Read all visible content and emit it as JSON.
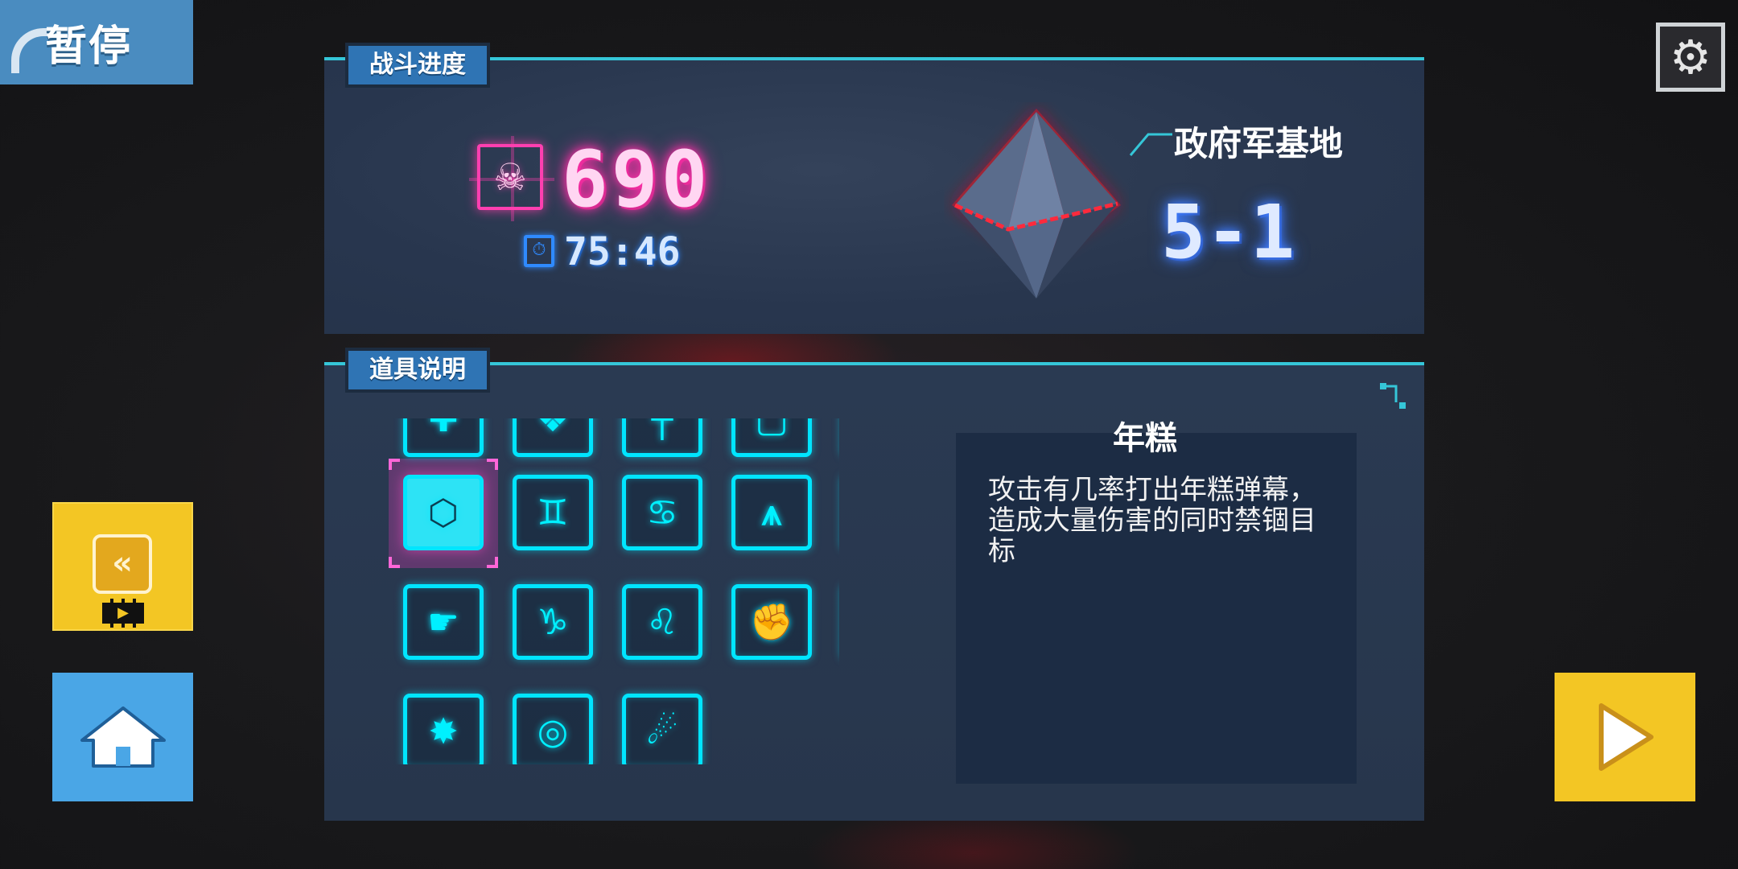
{
  "pause": {
    "label": "暂停"
  },
  "settings": {
    "icon": "gear-icon"
  },
  "battle_progress": {
    "tab_label": "战斗进度",
    "kill_count": "690",
    "timer": "75:46",
    "location_name": "政府军基地",
    "stage": "5-1"
  },
  "item_info": {
    "tab_label": "道具说明",
    "items": [
      {
        "name": "partial-top-1",
        "glyph": "✚"
      },
      {
        "name": "partial-top-2",
        "glyph": "❖"
      },
      {
        "name": "partial-top-3",
        "glyph": "┼"
      },
      {
        "name": "partial-top-4",
        "glyph": "▢"
      },
      {
        "name": "partial-top-5",
        "glyph": "◉"
      },
      {
        "name": "nian-gao",
        "glyph": "⬡"
      },
      {
        "name": "gemini",
        "glyph": "♊"
      },
      {
        "name": "cancer",
        "glyph": "♋"
      },
      {
        "name": "fangs",
        "glyph": "⩚"
      },
      {
        "name": "sagittarius",
        "glyph": "♐"
      },
      {
        "name": "gun-hand",
        "glyph": "☛"
      },
      {
        "name": "capricorn",
        "glyph": "♑"
      },
      {
        "name": "leo",
        "glyph": "♌"
      },
      {
        "name": "fist-heart",
        "glyph": "✊"
      },
      {
        "name": "medkit",
        "glyph": "✚"
      },
      {
        "name": "burst",
        "glyph": "✸"
      },
      {
        "name": "target-ring",
        "glyph": "◎"
      },
      {
        "name": "flame-bullet",
        "glyph": "☄"
      }
    ],
    "selected_title": "年糕",
    "selected_description": "攻击有几率打出年糕弹幕，造成大量伤害的同时禁锢目标"
  },
  "left_buttons": {
    "rewind_icon": "rewind-save-icon",
    "video_icon": "film-icon",
    "home_icon": "home-icon"
  },
  "right_buttons": {
    "play_icon": "play-icon"
  },
  "colors": {
    "panel": "#28364e",
    "accent_cyan": "#00e5ff",
    "kill_pink": "#ff3fb0",
    "timer_blue": "#2f8aff",
    "button_yellow": "#f3c624",
    "button_blue": "#4aa6e6"
  }
}
